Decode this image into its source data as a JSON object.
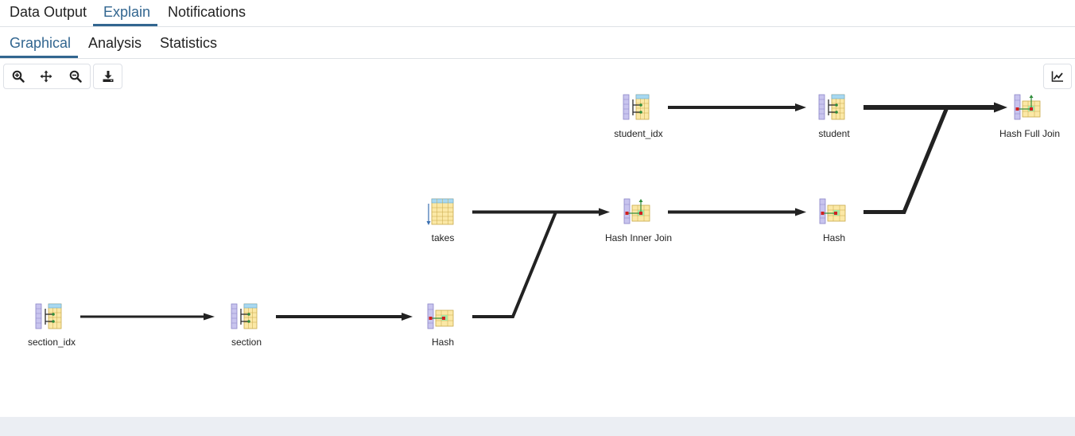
{
  "tabs": {
    "primary": [
      {
        "label": "Data Output",
        "active": false
      },
      {
        "label": "Explain",
        "active": true
      },
      {
        "label": "Notifications",
        "active": false
      }
    ],
    "secondary": [
      {
        "label": "Graphical",
        "active": true
      },
      {
        "label": "Analysis",
        "active": false
      },
      {
        "label": "Statistics",
        "active": false
      }
    ]
  },
  "toolbar": {
    "buttons": [
      {
        "icon": "zoom-in-icon"
      },
      {
        "icon": "move-icon"
      },
      {
        "icon": "zoom-out-icon"
      },
      {
        "icon": "download-icon"
      }
    ],
    "right_button": {
      "icon": "chart-line-icon"
    }
  },
  "plan": {
    "nodes": [
      {
        "id": "section_idx",
        "label": "section_idx",
        "icon": "index-scan-icon"
      },
      {
        "id": "section",
        "label": "section",
        "icon": "index-scan-icon"
      },
      {
        "id": "hash1",
        "label": "Hash",
        "icon": "hash-icon"
      },
      {
        "id": "takes",
        "label": "takes",
        "icon": "seq-scan-icon"
      },
      {
        "id": "hash_inner",
        "label": "Hash Inner Join",
        "icon": "hash-join-icon"
      },
      {
        "id": "hash2",
        "label": "Hash",
        "icon": "hash-icon"
      },
      {
        "id": "student_idx",
        "label": "student_idx",
        "icon": "index-scan-icon"
      },
      {
        "id": "student",
        "label": "student",
        "icon": "index-scan-icon"
      },
      {
        "id": "hash_full",
        "label": "Hash Full Join",
        "icon": "hash-join-icon"
      }
    ],
    "edges": [
      {
        "from": "section_idx",
        "to": "section",
        "weight": 3
      },
      {
        "from": "section",
        "to": "hash1",
        "weight": 4
      },
      {
        "from": "takes",
        "to": "hash_inner",
        "weight": 4
      },
      {
        "from": "hash1",
        "to": "hash_inner",
        "weight": 4
      },
      {
        "from": "hash_inner",
        "to": "hash2",
        "weight": 4
      },
      {
        "from": "student_idx",
        "to": "student",
        "weight": 4
      },
      {
        "from": "student",
        "to": "hash_full",
        "weight": 6
      },
      {
        "from": "hash2",
        "to": "hash_full",
        "weight": 5
      }
    ]
  }
}
